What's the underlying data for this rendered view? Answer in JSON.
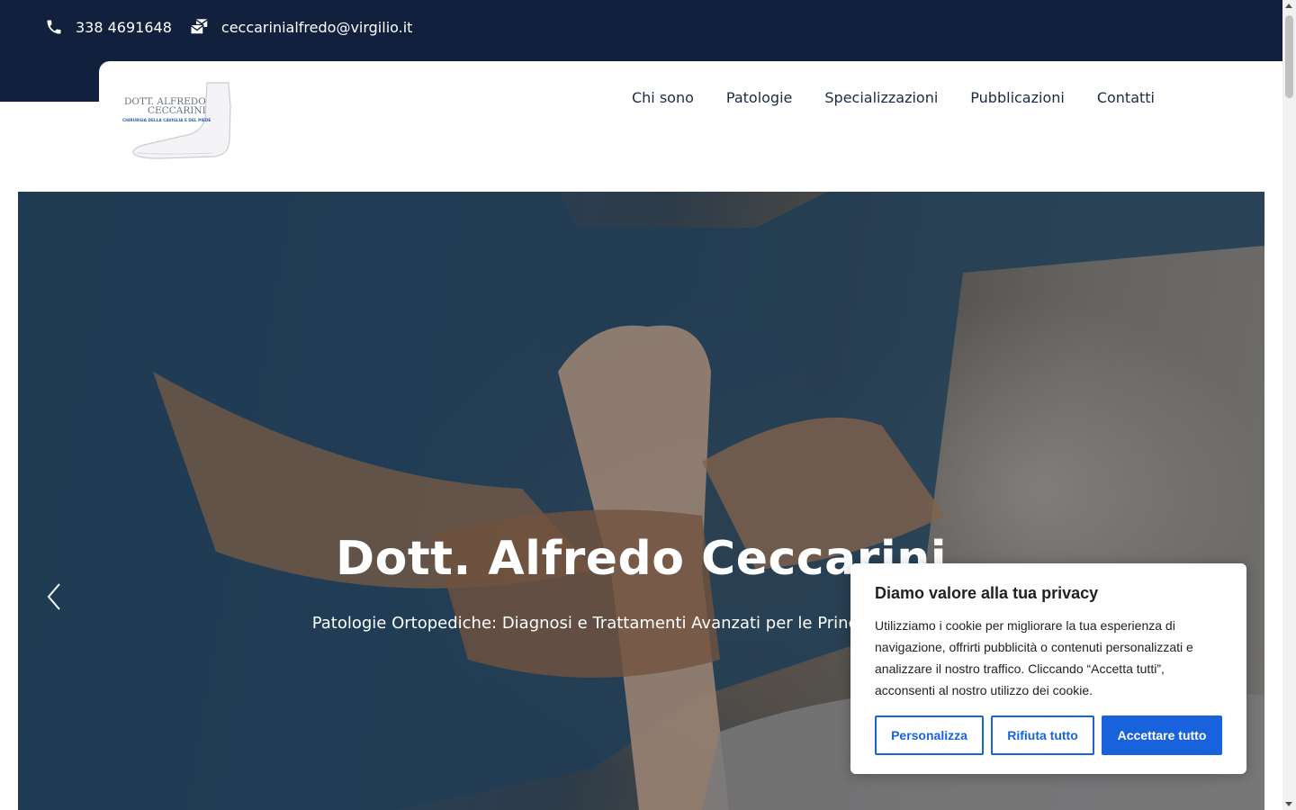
{
  "topbar": {
    "phone": "338 4691648",
    "email": "ceccarinialfredo@virgilio.it",
    "phone_icon": "phone-icon",
    "email_icon": "mail-icon",
    "background_color": "#11213d"
  },
  "logo": {
    "line1": "DOTT. ALFREDO",
    "line2": "CECCARINI",
    "tagline": "CHIRURGIA DELLA CAVIGLIA E DEL PIEDE"
  },
  "nav": {
    "items": [
      {
        "label": "Chi sono"
      },
      {
        "label": "Patologie"
      },
      {
        "label": "Specializzazioni"
      },
      {
        "label": "Pubblicazioni"
      },
      {
        "label": "Contatti"
      }
    ]
  },
  "hero": {
    "title": "Dott. Alfredo Ceccarini",
    "subtitle": "Patologie Ortopediche: Diagnosi e Trattamenti Avanzati per le Principali Patologie",
    "prev_icon": "chevron-left-icon"
  },
  "cookie_banner": {
    "title": "Diamo valore alla tua privacy",
    "text": "Utilizziamo i cookie per migliorare la tua esperienza di navigazione, offrirti pubblicità o contenuti personalizzati e analizzare il nostro traffico. Cliccando “Accetta tutti”, acconsenti al nostro utilizzo dei cookie.",
    "customize_label": "Personalizza",
    "reject_label": "Rifiuta tutto",
    "accept_label": "Accettare tutto",
    "accent_color": "#1863dc"
  }
}
